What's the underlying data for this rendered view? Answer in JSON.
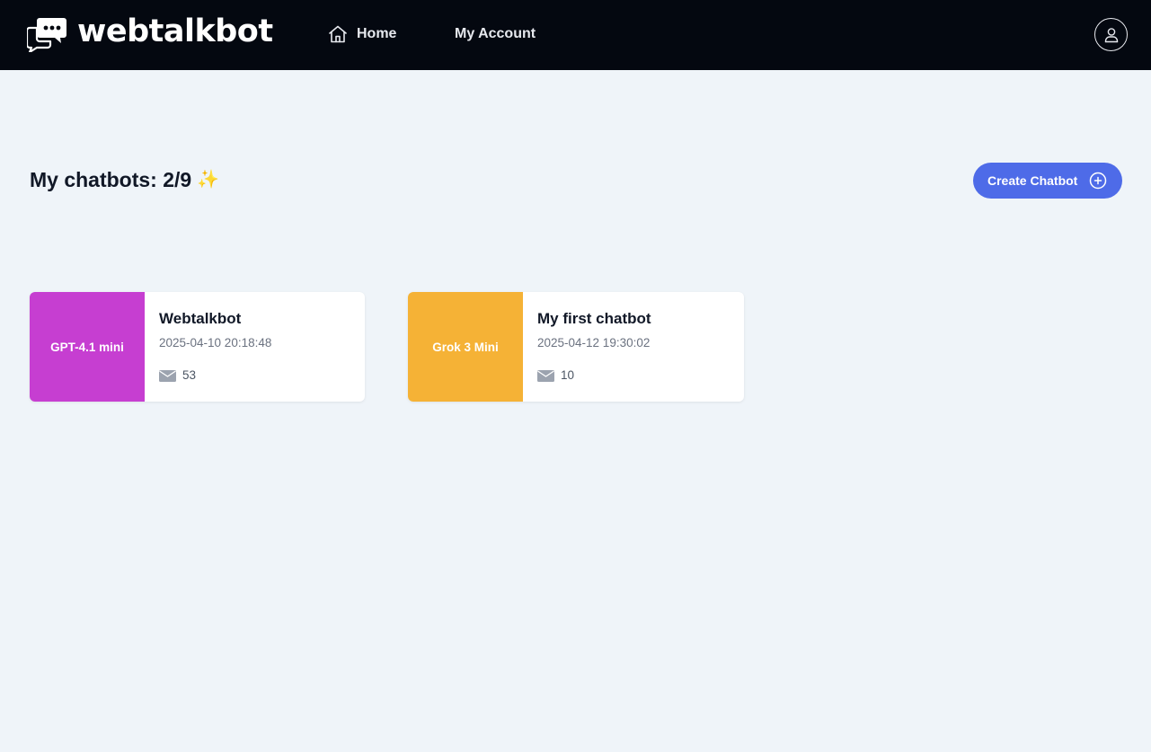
{
  "navbar": {
    "brand": "webtalkbot",
    "home_label": "Home",
    "account_label": "My Account",
    "icons": {
      "home": "home-icon",
      "user": "user-icon",
      "logo": "chat-bubbles-logo"
    }
  },
  "main": {
    "title": "My chatbots: 2/9",
    "title_emoji": "✨",
    "create_button_label": "Create Chatbot",
    "create_button_icon": "plus-circle-icon"
  },
  "chatbots": [
    {
      "model": "GPT-4.1 mini",
      "model_color": "#c63ed1",
      "name": "Webtalkbot",
      "created": "2025-04-10 20:18:48",
      "messages_icon": "envelope-icon",
      "messages_count": "53"
    },
    {
      "model": "Grok 3 Mini",
      "model_color": "#f5b236",
      "name": "My first chatbot",
      "created": "2025-04-12 19:30:02",
      "messages_icon": "envelope-icon",
      "messages_count": "10"
    }
  ],
  "colors": {
    "navbar_bg": "#040810",
    "page_bg": "#eff4f9",
    "accent": "#4e6be8"
  }
}
